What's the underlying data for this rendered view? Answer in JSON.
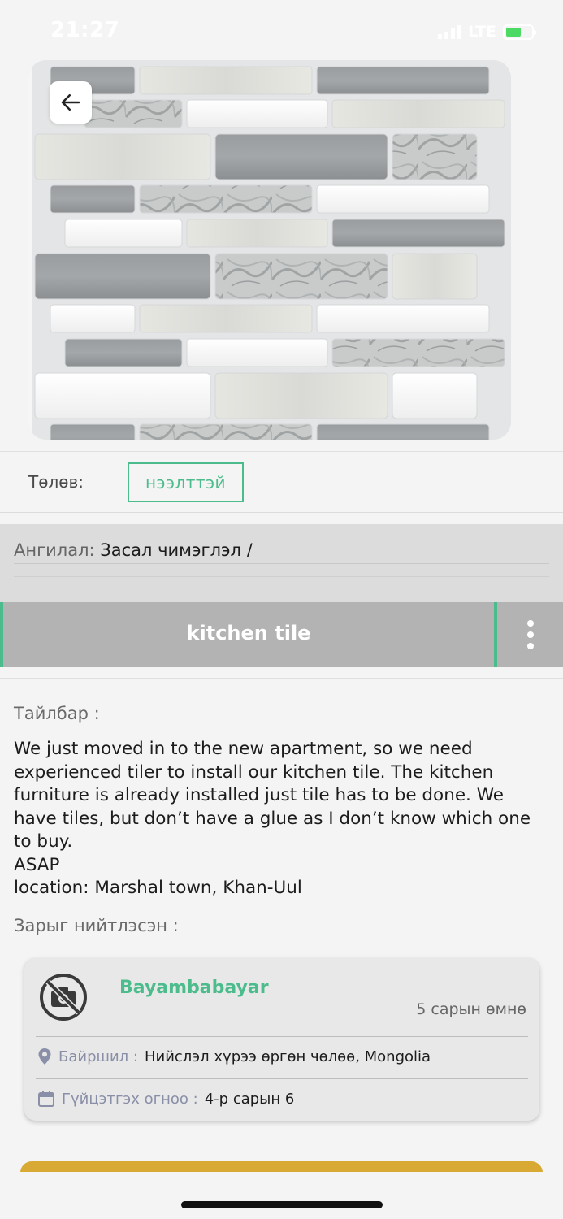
{
  "status_bar": {
    "time": "21:27",
    "network": "LTE",
    "battery_level": 0.6
  },
  "listing": {
    "image_alt": "kitchen-tile-sample",
    "status_label": "Төлөв:",
    "status_value": "нээлттэй",
    "category_label": "Ангилал:",
    "category_value": "Засал чимэглэл /",
    "title": "kitchen tile",
    "description_label": "Тайлбар :",
    "description": "We just moved in to the new apartment, so we need experienced tiler to install our kitchen tile. The kitchen furniture is already installed just tile has to be done. We have tiles, but don’t have a glue as I don’t know which one to buy.\nASAP\nlocation: Marshal town, Khan-Uul",
    "poster_label": "Зарыг нийтлэсэн :"
  },
  "poster": {
    "name": "Bayambabayar",
    "posted_ago": "5 сарын өмнө",
    "location_label": "Байршил :",
    "location_value": "Нийслэл хүрээ өргөн чөлөө, Mongolia",
    "deadline_label": "Гүйцэтгэх огноо :",
    "deadline_value": "4-р сарын 6"
  },
  "icons": {
    "back": "arrow-left-icon",
    "more": "more-vertical-icon",
    "avatar": "no-photo-icon",
    "location": "map-pin-icon",
    "calendar": "calendar-icon"
  },
  "colors": {
    "accent_green": "#4dbc8d",
    "title_bar": "#b3b3b3",
    "action_button": "#d9aa33",
    "label_muted": "#8a8fa8"
  }
}
